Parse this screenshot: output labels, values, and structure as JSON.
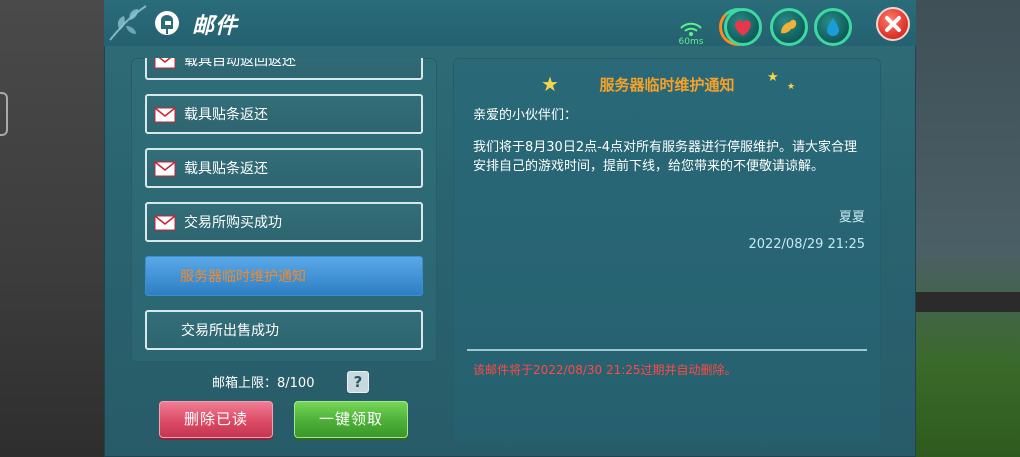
{
  "window": {
    "title": "邮件"
  },
  "status": {
    "ping": "60ms"
  },
  "mail_list": {
    "items": [
      {
        "label": "载具自动返回返还",
        "icon": "envelope-icon",
        "selected": false
      },
      {
        "label": "载具贴条返还",
        "icon": "envelope-icon",
        "selected": false
      },
      {
        "label": "载具贴条返还",
        "icon": "envelope-icon",
        "selected": false
      },
      {
        "label": "交易所购买成功",
        "icon": "envelope-icon",
        "selected": false
      },
      {
        "label": "服务器临时维护通知",
        "icon": "",
        "selected": true
      },
      {
        "label": "交易所出售成功",
        "icon": "",
        "selected": false
      }
    ],
    "capacity_label": "邮箱上限：8/100",
    "help_label": "?",
    "delete_read_label": "删除已读",
    "collect_all_label": "一键领取"
  },
  "mail_detail": {
    "title": "服务器临时维护通知",
    "greeting": "亲爱的小伙伴们：",
    "body": "我们将于8月30日2点-4点对所有服务器进行停服维护。请大家合理安排自己的游戏时间，提前下线，给您带来的不便敬请谅解。",
    "signature": "夏夏",
    "date": "2022/08/29 21:25",
    "expire_notice": "该邮件将于2022/08/30 21:25过期并自动删除。"
  },
  "colors": {
    "panel_bg": "#2a6471",
    "selected_item": "#3f8fd3",
    "selected_text": "#f08a2a",
    "title_orange": "#f4a12a",
    "expire_red": "#ff4a44",
    "delete_button": "#dc4b66",
    "collect_button": "#4caf37",
    "close_button": "#e0392e"
  }
}
